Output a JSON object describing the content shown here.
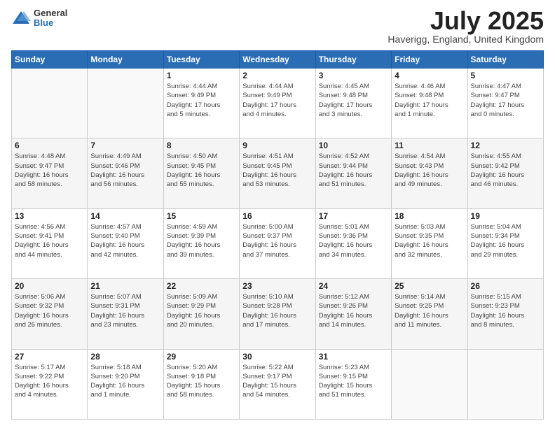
{
  "logo": {
    "general": "General",
    "blue": "Blue"
  },
  "title": {
    "month_year": "July 2025",
    "location": "Haverigg, England, United Kingdom"
  },
  "weekdays": [
    "Sunday",
    "Monday",
    "Tuesday",
    "Wednesday",
    "Thursday",
    "Friday",
    "Saturday"
  ],
  "weeks": [
    [
      {
        "day": "",
        "info": ""
      },
      {
        "day": "",
        "info": ""
      },
      {
        "day": "1",
        "info": "Sunrise: 4:44 AM\nSunset: 9:49 PM\nDaylight: 17 hours\nand 5 minutes."
      },
      {
        "day": "2",
        "info": "Sunrise: 4:44 AM\nSunset: 9:49 PM\nDaylight: 17 hours\nand 4 minutes."
      },
      {
        "day": "3",
        "info": "Sunrise: 4:45 AM\nSunset: 9:48 PM\nDaylight: 17 hours\nand 3 minutes."
      },
      {
        "day": "4",
        "info": "Sunrise: 4:46 AM\nSunset: 9:48 PM\nDaylight: 17 hours\nand 1 minute."
      },
      {
        "day": "5",
        "info": "Sunrise: 4:47 AM\nSunset: 9:47 PM\nDaylight: 17 hours\nand 0 minutes."
      }
    ],
    [
      {
        "day": "6",
        "info": "Sunrise: 4:48 AM\nSunset: 9:47 PM\nDaylight: 16 hours\nand 58 minutes."
      },
      {
        "day": "7",
        "info": "Sunrise: 4:49 AM\nSunset: 9:46 PM\nDaylight: 16 hours\nand 56 minutes."
      },
      {
        "day": "8",
        "info": "Sunrise: 4:50 AM\nSunset: 9:45 PM\nDaylight: 16 hours\nand 55 minutes."
      },
      {
        "day": "9",
        "info": "Sunrise: 4:51 AM\nSunset: 9:45 PM\nDaylight: 16 hours\nand 53 minutes."
      },
      {
        "day": "10",
        "info": "Sunrise: 4:52 AM\nSunset: 9:44 PM\nDaylight: 16 hours\nand 51 minutes."
      },
      {
        "day": "11",
        "info": "Sunrise: 4:54 AM\nSunset: 9:43 PM\nDaylight: 16 hours\nand 49 minutes."
      },
      {
        "day": "12",
        "info": "Sunrise: 4:55 AM\nSunset: 9:42 PM\nDaylight: 16 hours\nand 46 minutes."
      }
    ],
    [
      {
        "day": "13",
        "info": "Sunrise: 4:56 AM\nSunset: 9:41 PM\nDaylight: 16 hours\nand 44 minutes."
      },
      {
        "day": "14",
        "info": "Sunrise: 4:57 AM\nSunset: 9:40 PM\nDaylight: 16 hours\nand 42 minutes."
      },
      {
        "day": "15",
        "info": "Sunrise: 4:59 AM\nSunset: 9:39 PM\nDaylight: 16 hours\nand 39 minutes."
      },
      {
        "day": "16",
        "info": "Sunrise: 5:00 AM\nSunset: 9:37 PM\nDaylight: 16 hours\nand 37 minutes."
      },
      {
        "day": "17",
        "info": "Sunrise: 5:01 AM\nSunset: 9:36 PM\nDaylight: 16 hours\nand 34 minutes."
      },
      {
        "day": "18",
        "info": "Sunrise: 5:03 AM\nSunset: 9:35 PM\nDaylight: 16 hours\nand 32 minutes."
      },
      {
        "day": "19",
        "info": "Sunrise: 5:04 AM\nSunset: 9:34 PM\nDaylight: 16 hours\nand 29 minutes."
      }
    ],
    [
      {
        "day": "20",
        "info": "Sunrise: 5:06 AM\nSunset: 9:32 PM\nDaylight: 16 hours\nand 26 minutes."
      },
      {
        "day": "21",
        "info": "Sunrise: 5:07 AM\nSunset: 9:31 PM\nDaylight: 16 hours\nand 23 minutes."
      },
      {
        "day": "22",
        "info": "Sunrise: 5:09 AM\nSunset: 9:29 PM\nDaylight: 16 hours\nand 20 minutes."
      },
      {
        "day": "23",
        "info": "Sunrise: 5:10 AM\nSunset: 9:28 PM\nDaylight: 16 hours\nand 17 minutes."
      },
      {
        "day": "24",
        "info": "Sunrise: 5:12 AM\nSunset: 9:26 PM\nDaylight: 16 hours\nand 14 minutes."
      },
      {
        "day": "25",
        "info": "Sunrise: 5:14 AM\nSunset: 9:25 PM\nDaylight: 16 hours\nand 11 minutes."
      },
      {
        "day": "26",
        "info": "Sunrise: 5:15 AM\nSunset: 9:23 PM\nDaylight: 16 hours\nand 8 minutes."
      }
    ],
    [
      {
        "day": "27",
        "info": "Sunrise: 5:17 AM\nSunset: 9:22 PM\nDaylight: 16 hours\nand 4 minutes."
      },
      {
        "day": "28",
        "info": "Sunrise: 5:18 AM\nSunset: 9:20 PM\nDaylight: 16 hours\nand 1 minute."
      },
      {
        "day": "29",
        "info": "Sunrise: 5:20 AM\nSunset: 9:18 PM\nDaylight: 15 hours\nand 58 minutes."
      },
      {
        "day": "30",
        "info": "Sunrise: 5:22 AM\nSunset: 9:17 PM\nDaylight: 15 hours\nand 54 minutes."
      },
      {
        "day": "31",
        "info": "Sunrise: 5:23 AM\nSunset: 9:15 PM\nDaylight: 15 hours\nand 51 minutes."
      },
      {
        "day": "",
        "info": ""
      },
      {
        "day": "",
        "info": ""
      }
    ]
  ]
}
